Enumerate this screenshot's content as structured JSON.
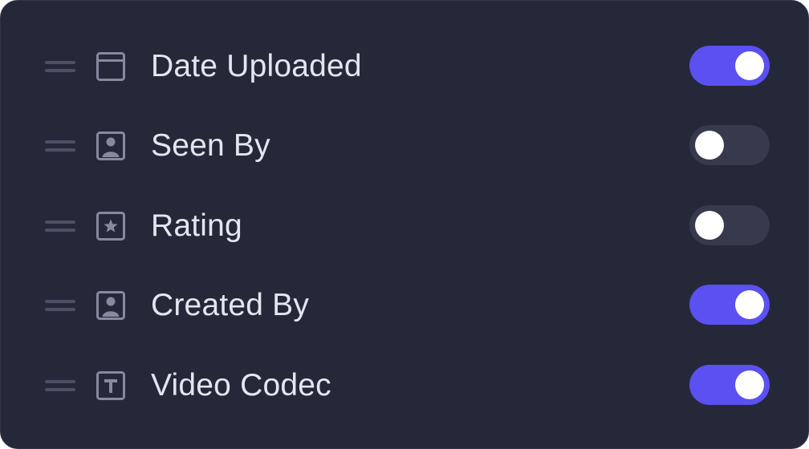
{
  "columns": [
    {
      "label": "Date Uploaded",
      "icon": "calendar-icon",
      "enabled": true
    },
    {
      "label": "Seen By",
      "icon": "person-portrait-icon",
      "enabled": false
    },
    {
      "label": "Rating",
      "icon": "star-box-icon",
      "enabled": false
    },
    {
      "label": "Created By",
      "icon": "person-portrait-icon",
      "enabled": true
    },
    {
      "label": "Video Codec",
      "icon": "text-box-icon",
      "enabled": true
    }
  ],
  "colors": {
    "panel_background": "#252839",
    "toggle_on": "#5b50f2",
    "toggle_off": "#373a4d",
    "icon": "#868aa0",
    "label_text": "#e4e5ee"
  }
}
